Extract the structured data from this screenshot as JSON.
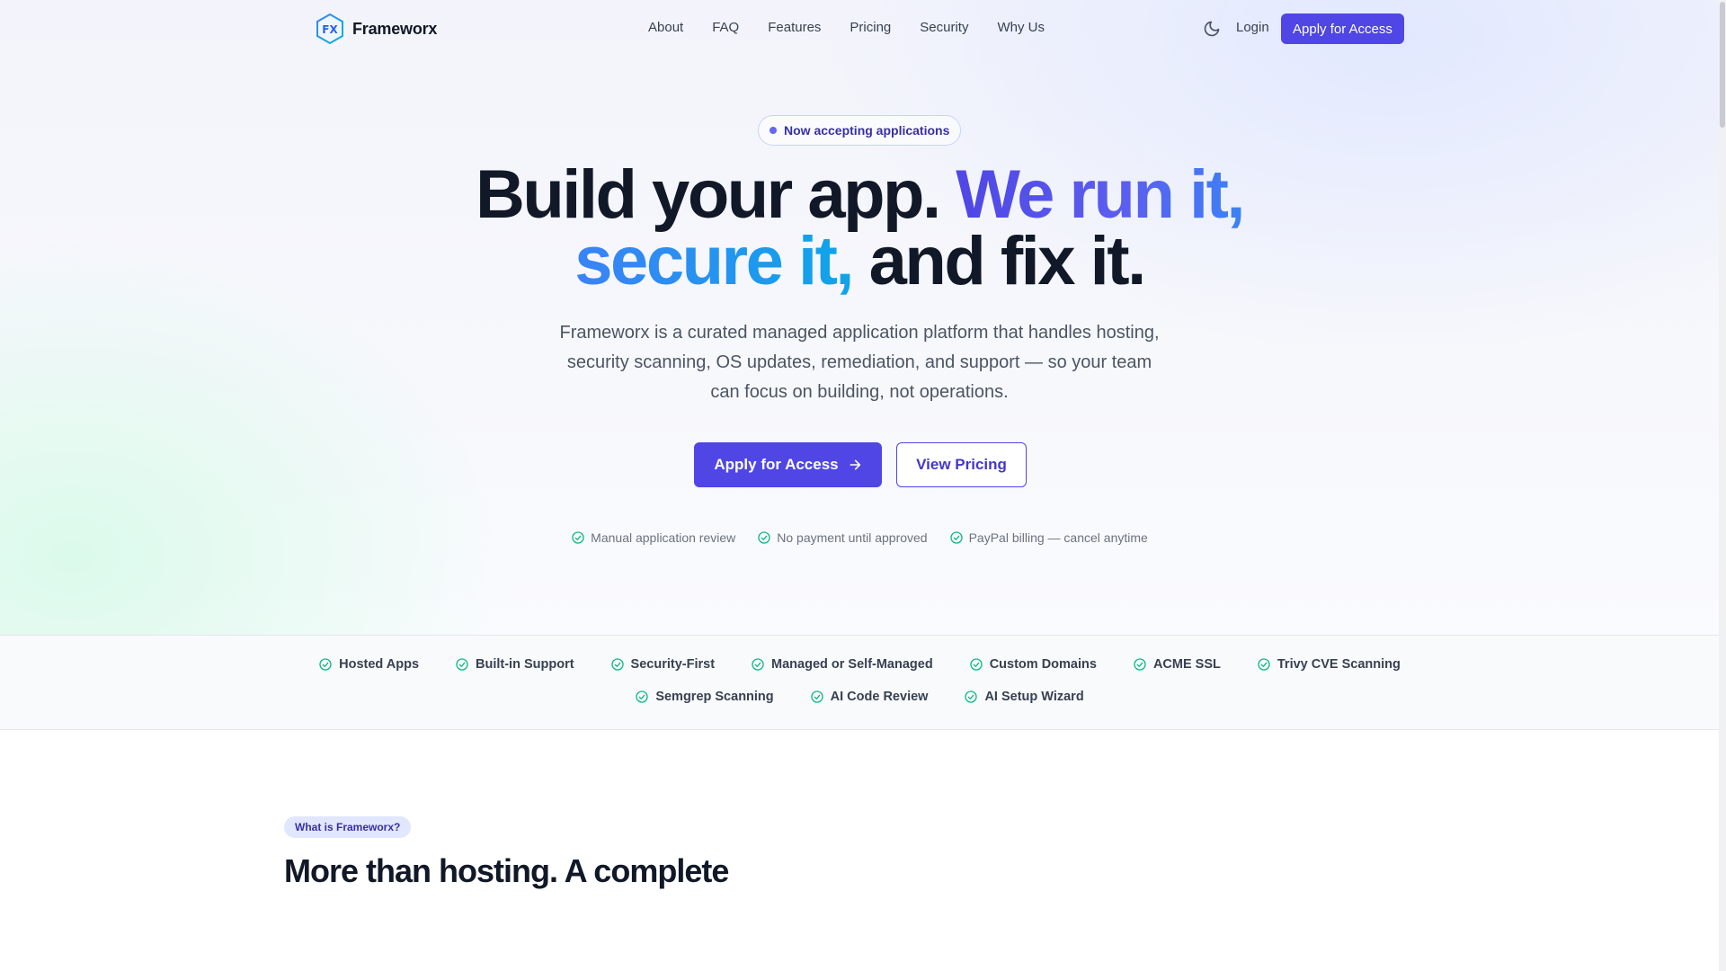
{
  "nav": {
    "brand_mark": "FX",
    "brand_name": "Frameworx",
    "links": [
      "About",
      "FAQ",
      "Features",
      "Pricing",
      "Security",
      "Why Us"
    ],
    "login": "Login",
    "cta": "Apply for Access"
  },
  "hero": {
    "pill": "Now accepting applications",
    "headline": {
      "part1": "Build your app. ",
      "part2": "We run it,",
      "part3": "secure it,",
      "part4": " and fix it."
    },
    "subtext": "Frameworx is a curated managed application platform that handles hosting, security scanning, OS updates, remediation, and support — so your team can focus on building, not operations.",
    "primary_cta": "Apply for Access",
    "secondary_cta": "View Pricing",
    "assurances": [
      "Manual application review",
      "No payment until approved",
      "PayPal billing — cancel anytime"
    ]
  },
  "features": {
    "row1": [
      "Hosted Apps",
      "Built-in Support",
      "Security-First",
      "Managed or Self-Managed",
      "Custom Domains",
      "ACME SSL",
      "Trivy CVE Scanning"
    ],
    "row2": [
      "Semgrep Scanning",
      "AI Code Review",
      "AI Setup Wizard"
    ]
  },
  "section": {
    "tag": "What is Frameworx?",
    "title": "More than hosting. A complete"
  },
  "colors": {
    "accent": "#4f46e5",
    "accent_blue": "#2563eb",
    "check_green": "#10b981",
    "text_dark": "#111827"
  },
  "icons": {
    "logo": "hexagon-logo-icon",
    "theme": "moon-icon",
    "arrow": "arrow-right-icon",
    "check": "check-circle-icon"
  }
}
